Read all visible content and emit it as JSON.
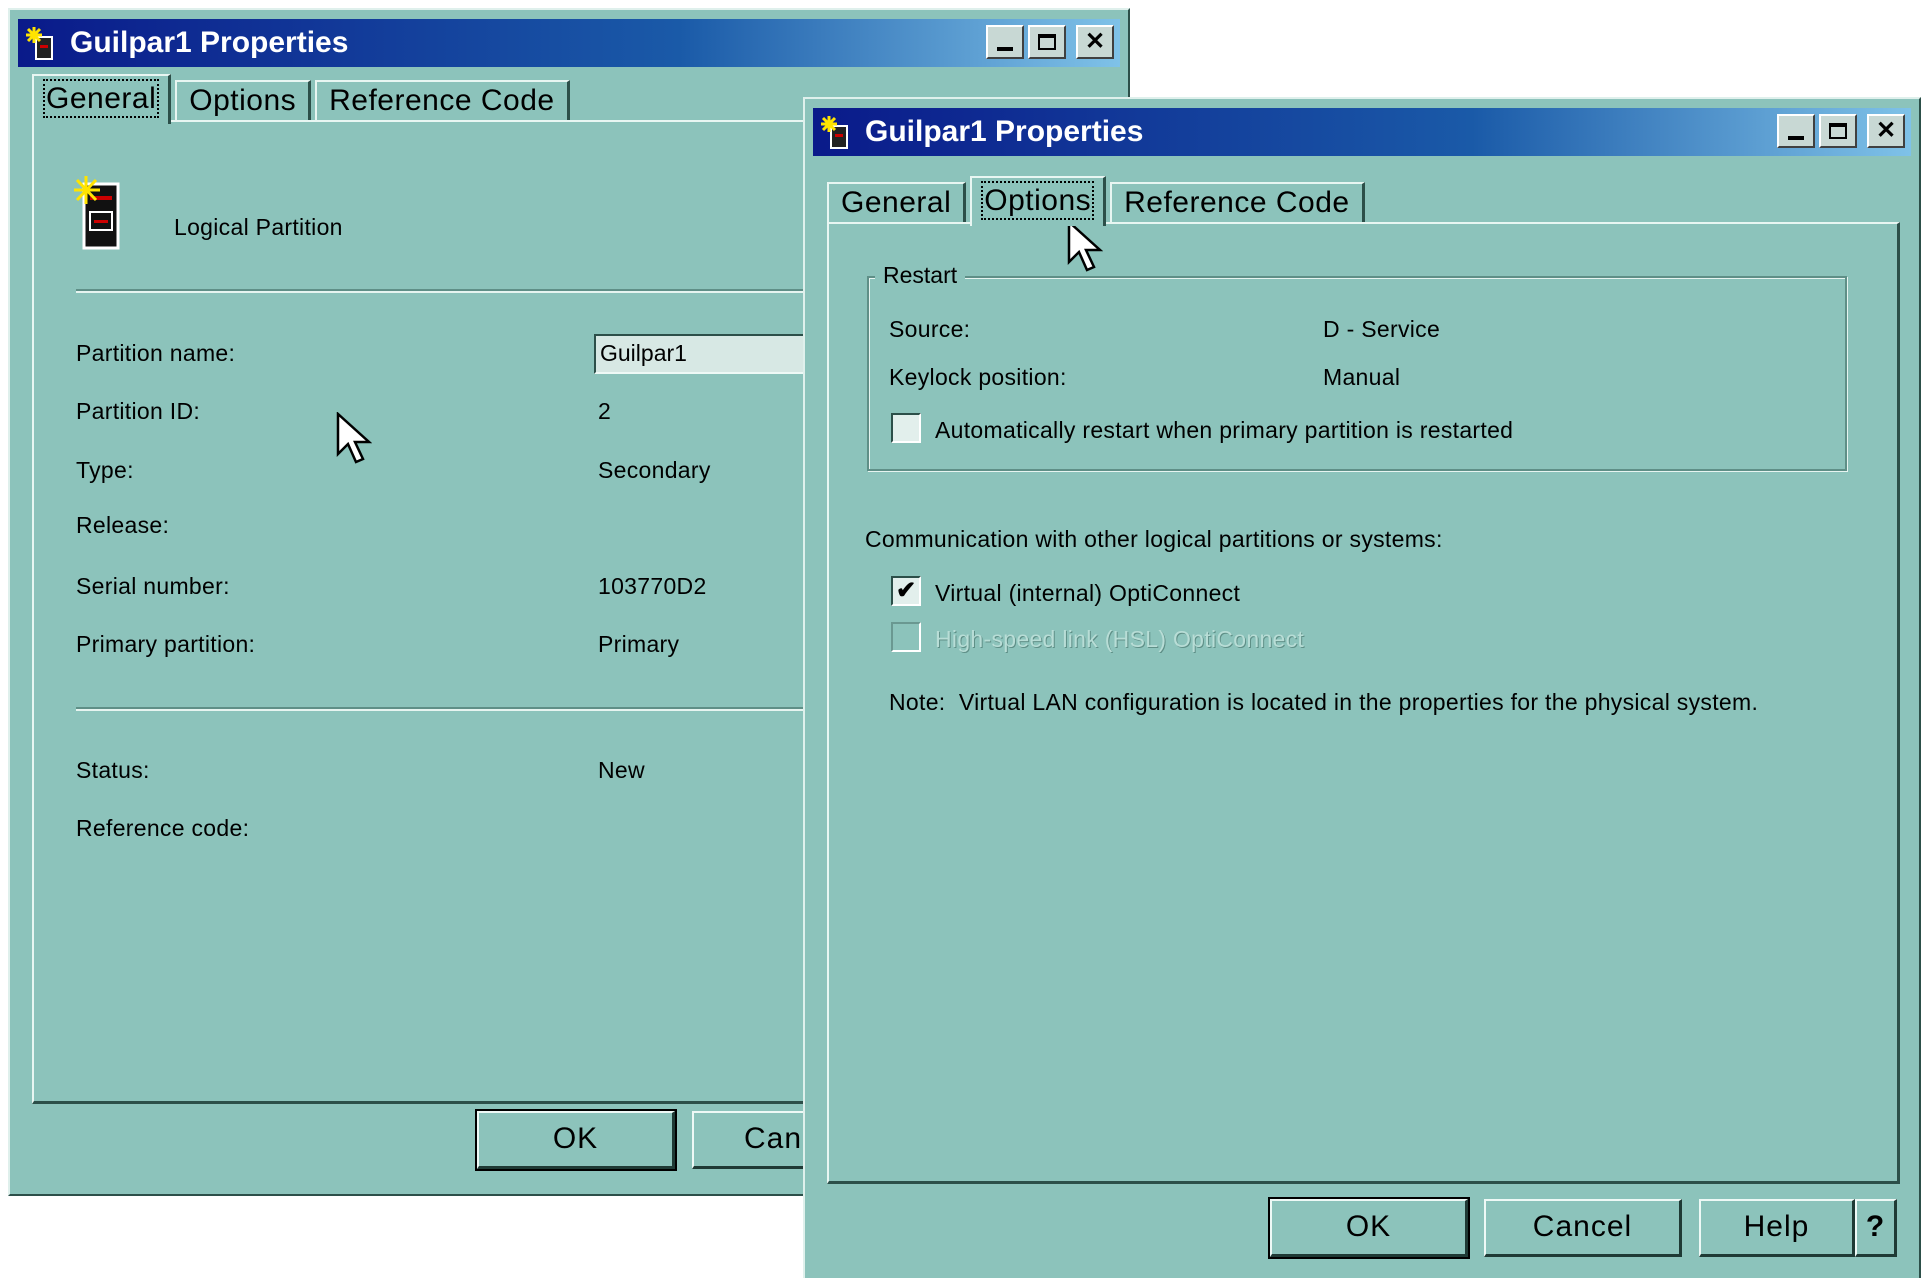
{
  "window_back": {
    "title": "Guilpar1 Properties",
    "tabs": [
      "General",
      "Options",
      "Reference Code"
    ],
    "active_tab": "General",
    "header_label": "Logical Partition",
    "fields": {
      "partition_name_label": "Partition name:",
      "partition_name_value": "Guilpar1",
      "partition_id_label": "Partition ID:",
      "partition_id_value": "2",
      "type_label": "Type:",
      "type_value": "Secondary",
      "release_label": "Release:",
      "serial_label": "Serial number:",
      "serial_value": "103770D2",
      "primary_label": "Primary partition:",
      "primary_value": "Primary",
      "status_label": "Status:",
      "status_value": "New",
      "refcode_label": "Reference code:"
    },
    "buttons": {
      "ok": "OK",
      "cancel": "Can"
    }
  },
  "window_front": {
    "title": "Guilpar1 Properties",
    "tabs": [
      "General",
      "Options",
      "Reference Code"
    ],
    "active_tab": "Options",
    "restart": {
      "group_title": "Restart",
      "source_label": "Source:",
      "source_value": "D - Service",
      "keylock_label": "Keylock position:",
      "keylock_value": "Manual",
      "auto_restart_label": "Automatically restart when primary partition is restarted",
      "auto_restart_checked": false
    },
    "communication": {
      "heading": "Communication with other logical partitions or systems:",
      "virtual_label": "Virtual (internal) OptiConnect",
      "virtual_checked": true,
      "hsl_label": "High-speed link (HSL) OptiConnect",
      "hsl_checked": false,
      "hsl_enabled": false
    },
    "note": "Note:  Virtual LAN configuration is located in the properties for the physical system.",
    "buttons": {
      "ok": "OK",
      "cancel": "Cancel",
      "help": "Help",
      "whats_this": "?"
    }
  },
  "colors": {
    "window_face": "#8cc3bb",
    "titlebar_start": "#0a1a8a",
    "titlebar_end": "#7fc2e8",
    "checkmark": "#000000"
  }
}
